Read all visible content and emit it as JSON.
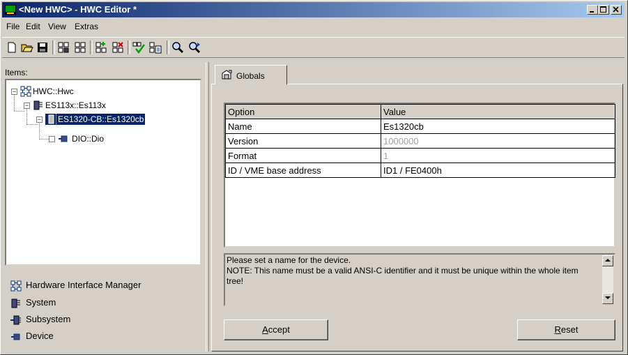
{
  "window": {
    "title": "<New HWC> - HWC Editor  *",
    "controls": [
      "minimize-icon",
      "maximize-icon",
      "close-icon"
    ]
  },
  "menu": [
    "File",
    "Edit",
    "View",
    "Extras"
  ],
  "toolbar": {
    "icons": [
      "new-icon",
      "open-icon",
      "save-icon",
      "add-system-icon",
      "add-subsystem-icon",
      "add-device-icon",
      "remove-device-icon",
      "check-icon",
      "generate-icon",
      "find-icon",
      "find-next-icon"
    ]
  },
  "items_label": "Items:",
  "tree": {
    "nodes": [
      {
        "label": "HWC::Hwc",
        "icon": "hardware-interface-manager-icon",
        "expander": "−",
        "selected": false
      },
      {
        "label": "ES113x::Es113x",
        "icon": "system-icon",
        "expander": "−",
        "selected": false
      },
      {
        "label": "ES1320-CB::Es1320cb",
        "icon": "subsystem-icon",
        "expander": "−",
        "selected": true
      },
      {
        "label": "DIO::Dio",
        "icon": "device-icon",
        "expander": "",
        "selected": false
      }
    ]
  },
  "legend": [
    {
      "label": "Hardware Interface Manager",
      "icon": "hardware-interface-manager-icon"
    },
    {
      "label": "System",
      "icon": "system-icon"
    },
    {
      "label": "Subsystem",
      "icon": "subsystem-icon"
    },
    {
      "label": "Device",
      "icon": "device-icon"
    }
  ],
  "tab": {
    "label": "Globals",
    "icon": "globals-icon"
  },
  "properties": {
    "headers": [
      "Option",
      "Value"
    ],
    "rows": [
      {
        "option": "Name",
        "value": "Es1320cb",
        "readonly": false
      },
      {
        "option": "Version",
        "value": "1000000",
        "readonly": true
      },
      {
        "option": "Format",
        "value": "1",
        "readonly": true
      },
      {
        "option": "ID / VME base address",
        "value": "ID1 / FE0400h",
        "readonly": false
      }
    ]
  },
  "description": {
    "line1": "Please set a name for the device.",
    "line2": "NOTE: This name must be a valid ANSI-C identifier and it must be unique within the whole item tree!"
  },
  "buttons": {
    "accept_prefix": "A",
    "accept_rest": "ccept",
    "reset_prefix": "R",
    "reset_rest": "eset"
  },
  "colors": {
    "titlebar_start": "#0a246a",
    "titlebar_end": "#a6caf0",
    "face": "#d4d0c8",
    "selection": "#0a246a"
  }
}
